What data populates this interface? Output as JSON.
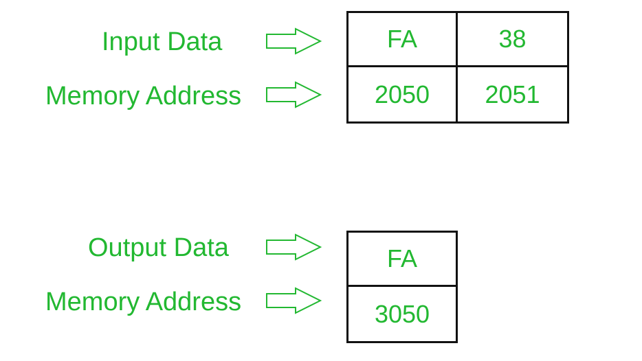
{
  "input": {
    "data_label": "Input Data",
    "address_label": "Memory Address",
    "data_values": [
      "FA",
      "38"
    ],
    "address_values": [
      "2050",
      "2051"
    ]
  },
  "output": {
    "data_label": "Output Data",
    "address_label": "Memory Address",
    "data_values": [
      "FA"
    ],
    "address_values": [
      "3050"
    ]
  },
  "colors": {
    "text": "#22b831",
    "border": "#111111",
    "background": "#ffffff"
  },
  "icons": {
    "arrow": "hollow-right-arrow-icon"
  }
}
